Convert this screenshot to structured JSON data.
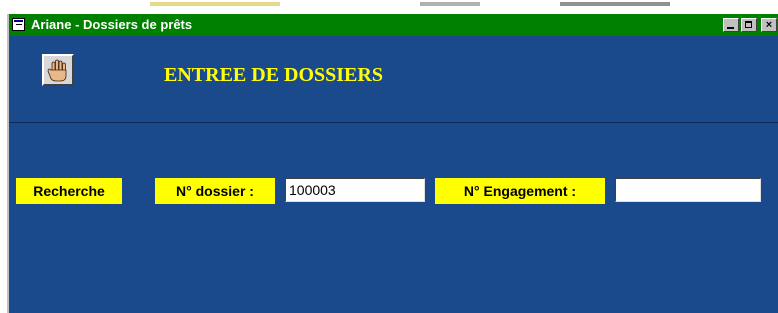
{
  "window": {
    "title": "Ariane - Dossiers de prêts",
    "controls": {
      "minimize": "_",
      "close": "×"
    }
  },
  "header": {
    "heading": "ENTREE  DE DOSSIERS",
    "stop_icon": "hand-stop-icon"
  },
  "search": {
    "section_label": "Recherche",
    "dossier_label": "N° dossier :",
    "dossier_value": "100003",
    "engagement_label": "N° Engagement :",
    "engagement_value": ""
  },
  "colors": {
    "titlebar": "#008000",
    "background": "#1b4a8c",
    "accent_text": "#ffff00",
    "label_bg": "#ffff00"
  }
}
